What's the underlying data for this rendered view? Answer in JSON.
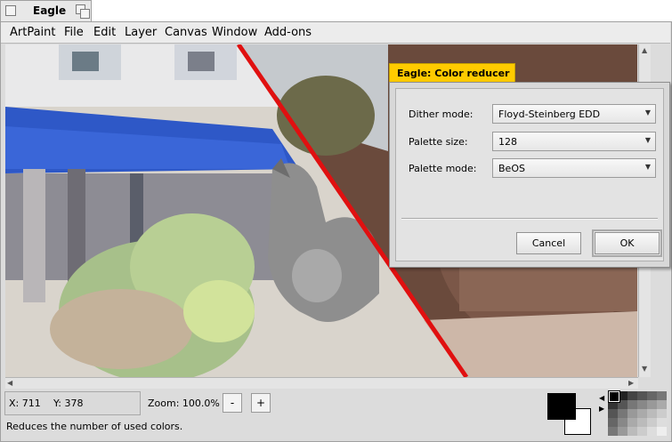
{
  "window": {
    "title": "Eagle"
  },
  "menu": [
    "ArtPaint",
    "File",
    "Edit",
    "Layer",
    "Canvas",
    "Window",
    "Add-ons"
  ],
  "status": {
    "x_label": "X: 711",
    "y_label": "Y: 378",
    "zoom_label": "Zoom: 100.0%",
    "zoom_out": "-",
    "zoom_in": "+",
    "message": "Reduces the number of used colors."
  },
  "colors": {
    "dialog_tab": "#ffcb00",
    "foreground": "#000000",
    "background": "#ffffff",
    "divider_line": "#e01010"
  },
  "dialog": {
    "title": "Eagle: Color reducer",
    "dither_label": "Dither mode:",
    "dither_value": "Floyd-Steinberg EDD",
    "palette_size_label": "Palette size:",
    "palette_size_value": "128",
    "palette_mode_label": "Palette mode:",
    "palette_mode_value": "BeOS",
    "cancel": "Cancel",
    "ok": "OK"
  },
  "icons": {
    "scroll_up": "arrow-up-icon",
    "scroll_down": "arrow-down-icon",
    "scroll_left": "arrow-left-icon",
    "scroll_right": "arrow-right-icon",
    "select_caret": "chevron-down-icon"
  }
}
